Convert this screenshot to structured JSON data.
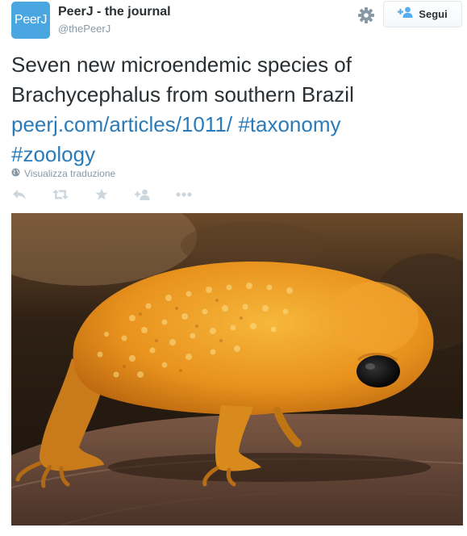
{
  "profile": {
    "avatar_text": "PeerJ",
    "display_name": "PeerJ - the journal",
    "handle": "@thePeerJ"
  },
  "header": {
    "follow_label": "Segui",
    "settings_icon": "gear-icon",
    "follow_icon": "add-user-icon"
  },
  "tweet": {
    "text_line1": "Seven new microendemic species of",
    "text_line2": "Brachycephalus from southern Brazil",
    "link": "peerj.com/articles/1011/",
    "hashtag1": "#taxonomy",
    "hashtag2": "#zoology"
  },
  "translate": {
    "label": "Visualizza traduzione",
    "icon": "globe-icon"
  },
  "actions": {
    "icons": [
      "reply-icon",
      "retweet-icon",
      "favorite-icon",
      "follow-icon",
      "more-icon"
    ]
  },
  "colors": {
    "accent": "#55acee",
    "link": "#2b7bb9",
    "muted": "#8899a6",
    "avatar_bg": "#4aa6e0"
  }
}
